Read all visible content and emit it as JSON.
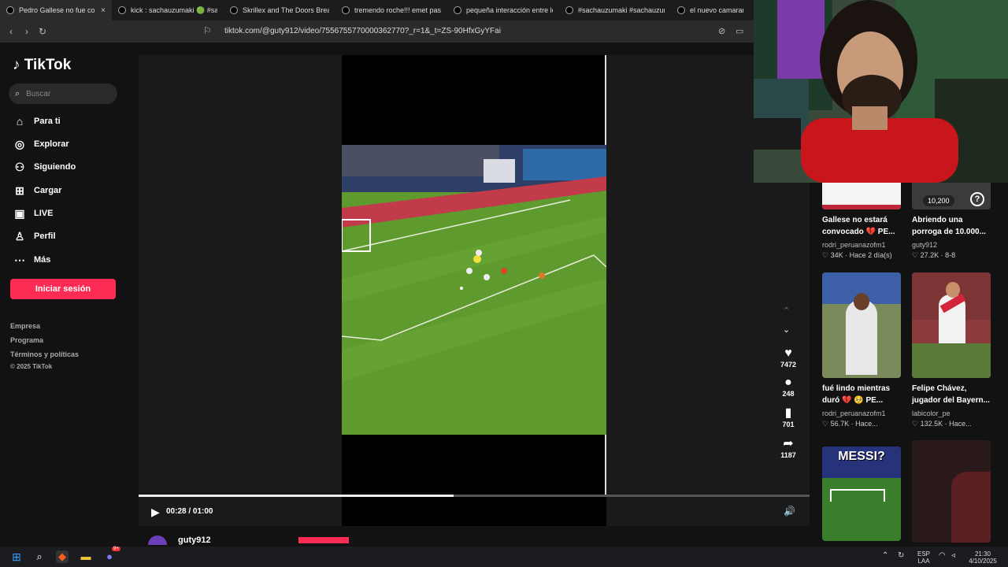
{
  "browser": {
    "tabs": [
      {
        "title": "Pedro Gallese no fue co",
        "active": true
      },
      {
        "title": "kick : sachauzumaki 🟢 #sa",
        "active": false
      },
      {
        "title": "Skrillex and The Doors Breakn",
        "active": false
      },
      {
        "title": "tremendo roche!!! emet pasa d",
        "active": false
      },
      {
        "title": "pequeña interacción entre los",
        "active": false
      },
      {
        "title": "#sachauzumaki #sachauzumak",
        "active": false
      },
      {
        "title": "el nuevo camaraman",
        "active": false
      }
    ],
    "close_glyph": "×",
    "url": "tiktok.com/@guty912/video/7556755770000362770?_r=1&_t=ZS-90HfxGyYFai"
  },
  "sidebar": {
    "logo": "TikTok",
    "search_placeholder": "Buscar",
    "nav": [
      {
        "label": "Para ti",
        "icon": "home-icon",
        "glyph": "⌂"
      },
      {
        "label": "Explorar",
        "icon": "compass-icon",
        "glyph": "◎"
      },
      {
        "label": "Siguiendo",
        "icon": "following-icon",
        "glyph": "⚇"
      },
      {
        "label": "Cargar",
        "icon": "upload-icon",
        "glyph": "⊞"
      },
      {
        "label": "LIVE",
        "icon": "live-icon",
        "glyph": "▣"
      },
      {
        "label": "Perfil",
        "icon": "profile-icon",
        "glyph": "♙"
      },
      {
        "label": "Más",
        "icon": "more-icon",
        "glyph": "⋯"
      }
    ],
    "login_label": "Iniciar sesión",
    "footer": [
      "Empresa",
      "Programa",
      "Términos y políticas",
      "© 2025 TikTok"
    ]
  },
  "player": {
    "time": "00:28 / 01:00",
    "progress": 0.47,
    "likes": "7472",
    "comments": "248",
    "saves": "701",
    "shares": "1187",
    "author": "guty912"
  },
  "recommendations": [
    {
      "title": "Gallese no estará convocado 💔 PE...",
      "author": "rodri_peruanazofm1",
      "stats": "♡ 34K · Hace 2 día(s)",
      "thumb_text": ""
    },
    {
      "title": "Abriendo una porroga de 10.000...",
      "author": "guty912",
      "stats": "♡ 27.2K · 8-8",
      "thumb_text": "10,200"
    },
    {
      "title": "fué lindo mientras duró 💔 🥺 PE...",
      "author": "rodri_peruanazofm1",
      "stats": "♡ 56.7K · Hace...",
      "thumb_text": ""
    },
    {
      "title": "Felipe Chávez, jugador del Bayern...",
      "author": "labicolor_pe",
      "stats": "♡ 132.5K · Hace...",
      "thumb_text": ""
    },
    {
      "title": "",
      "author": "",
      "stats": "",
      "thumb_text": "MESSI?"
    },
    {
      "title": "",
      "author": "",
      "stats": "",
      "thumb_text": ""
    }
  ],
  "taskbar": {
    "lang_top": "ESP",
    "lang_bottom": "LAA",
    "time": "21:30",
    "date": "4/10/2025",
    "badge": "9+"
  },
  "colors": {
    "accent": "#fe2c55",
    "pitch": "#5f9a2e"
  }
}
